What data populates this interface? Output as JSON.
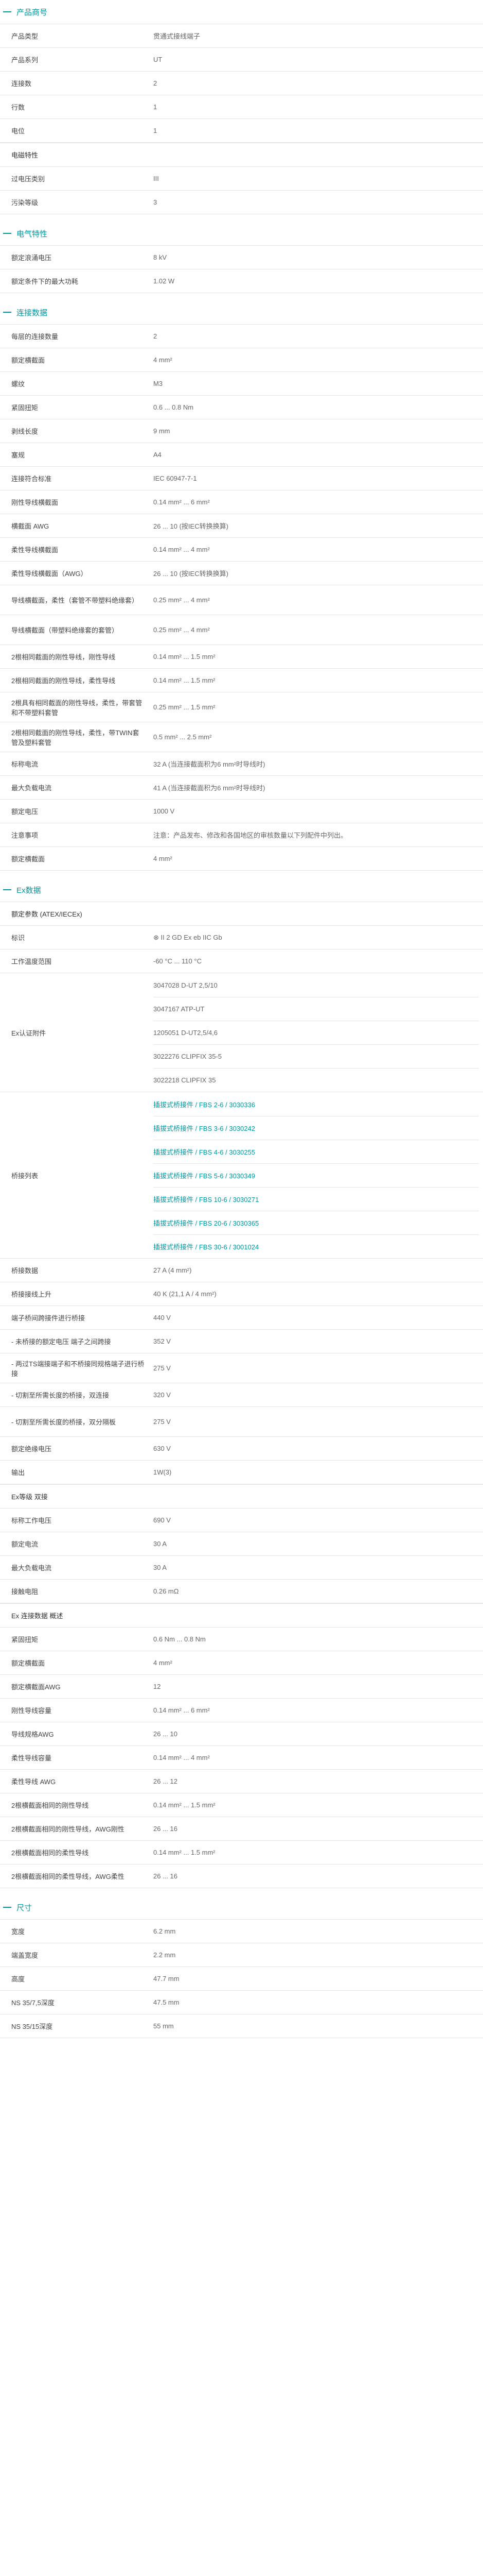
{
  "sections": [
    {
      "title": "产品商号",
      "blocks": [
        {
          "rows": [
            {
              "k": "产品类型",
              "v": [
                "贯通式接线端子"
              ],
              "h": 46
            },
            {
              "k": "产品系列",
              "v": [
                "UT"
              ],
              "h": 46
            },
            {
              "k": "连接数",
              "v": [
                "2"
              ],
              "h": 46
            },
            {
              "k": "行数",
              "v": [
                "1"
              ],
              "h": 46
            },
            {
              "k": "电位",
              "v": [
                "1"
              ],
              "h": 46
            }
          ]
        },
        {
          "subhead": "电磁特性"
        },
        {
          "rows": [
            {
              "k": "过电压类别",
              "v": [
                "III"
              ],
              "h": 46
            },
            {
              "k": "污染等级",
              "v": [
                "3"
              ],
              "h": 46
            }
          ]
        }
      ]
    },
    {
      "title": "电气特性",
      "blocks": [
        {
          "rows": [
            {
              "k": "额定浪涌电压",
              "v": [
                "8 kV"
              ],
              "h": 46
            },
            {
              "k": "额定条件下的最大功耗",
              "v": [
                "1.02 W"
              ],
              "h": 46
            }
          ]
        }
      ]
    },
    {
      "title": "连接数据",
      "blocks": [
        {
          "rows": [
            {
              "k": "每层的连接数量",
              "v": [
                "2"
              ],
              "h": 46
            },
            {
              "k": "额定横截面",
              "v": [
                "4 mm²"
              ],
              "h": 46
            },
            {
              "k": "螺纹",
              "v": [
                "M3"
              ],
              "h": 46
            },
            {
              "k": "紧固扭矩",
              "v": [
                "0.6 ... 0.8 Nm"
              ],
              "h": 46
            },
            {
              "k": "剥线长度",
              "v": [
                "9 mm"
              ],
              "h": 46
            },
            {
              "k": "塞规",
              "v": [
                "A4"
              ],
              "h": 46
            },
            {
              "k": "连接符合标准",
              "v": [
                "IEC 60947-7-1"
              ],
              "h": 46
            },
            {
              "k": "刚性导线横截面",
              "v": [
                "0.14 mm² ... 6 mm²"
              ],
              "h": 46
            },
            {
              "k": "横截面 AWG",
              "v": [
                "26 ... 10 (按IEC转换换算)"
              ],
              "h": 46
            },
            {
              "k": "柔性导线横截面",
              "v": [
                "0.14 mm² ... 4 mm²"
              ],
              "h": 46
            },
            {
              "k": "柔性导线横截面（AWG）",
              "v": [
                "26 ... 10 (按IEC转换换算)"
              ],
              "h": 46
            },
            {
              "k": "导线横截面，柔性（套管不带塑料绝缘套）",
              "v": [
                "0.25 mm² ... 4 mm²"
              ],
              "h": 58
            },
            {
              "k": "导线横截面（带塑料绝缘套的套管）",
              "v": [
                "0.25 mm² ... 4 mm²"
              ],
              "h": 58
            },
            {
              "k": "2根相同截面的刚性导线，刚性导线",
              "v": [
                "0.14 mm² ... 1.5 mm²"
              ],
              "h": 46
            },
            {
              "k": "2根相同截面的刚性导线，柔性导线",
              "v": [
                "0.14 mm² ... 1.5 mm²"
              ],
              "h": 46
            },
            {
              "k": "2根具有相同截面的刚性导线，柔性，带套管和不带塑料套管",
              "v": [
                "0.25 mm² ... 1.5 mm²"
              ],
              "h": 58
            },
            {
              "k": "2根相同截面的刚性导线，柔性，带TWIN套管及塑料套管",
              "v": [
                "0.5 mm² ... 2.5 mm²"
              ],
              "h": 58
            },
            {
              "k": "标称电流",
              "v": [
                "32 A (当连接截面积为6 mm²时导线时)"
              ],
              "h": 46
            },
            {
              "k": "最大负载电流",
              "v": [
                "41 A (当连接截面积为6 mm²时导线时)"
              ],
              "h": 46
            },
            {
              "k": "额定电压",
              "v": [
                "1000 V"
              ],
              "h": 46
            },
            {
              "k": "注意事项",
              "v": [
                "注意：产品发布、修改和各国地区的审核数量以下列配件中列出。"
              ],
              "h": 46
            },
            {
              "k": "额定横截面",
              "v": [
                "4 mm²"
              ],
              "h": 46
            }
          ]
        }
      ]
    },
    {
      "title": "Ex数据",
      "blocks": [
        {
          "subhead": "额定参数 (ATEX/IECEx)"
        },
        {
          "rows": [
            {
              "k": "标识",
              "v": [
                "⊗ II 2 GD Ex eb IIC Gb"
              ],
              "h": 46
            },
            {
              "k": "工作温度范围",
              "v": [
                "-60 °C ... 110 °C"
              ],
              "h": 46
            },
            {
              "k": "Ex认证附件",
              "v": [
                "3047028 D-UT 2,5/10",
                "3047167 ATP-UT",
                "1205051 D-UT2,5/4,6",
                "3022276 CLIPFIX 35-5",
                "3022218 CLIPFIX 35"
              ],
              "h": 46
            },
            {
              "k": "桥接列表",
              "v": [
                "插拔式桥接件 / FBS 2-6 / 3030336",
                "插拔式桥接件 / FBS 3-6 / 3030242",
                "插拔式桥接件 / FBS 4-6 / 3030255",
                "插拔式桥接件 / FBS 5-6 / 3030349",
                "插拔式桥接件 / FBS 10-6 / 3030271",
                "插拔式桥接件 / FBS 20-6 / 3030365",
                "插拔式桥接件 / FBS 30-6 / 3001024"
              ],
              "h": 46,
              "link": true
            },
            {
              "k": "桥接数据",
              "v": [
                "27 A (4 mm²)"
              ],
              "h": 46
            },
            {
              "k": "桥接接线上升",
              "v": [
                "40 K (21,1 A / 4 mm²)"
              ],
              "h": 46
            },
            {
              "k": "端子桥间跨接件进行桥接",
              "v": [
                "440 V"
              ],
              "h": 46
            },
            {
              "k": "- 未桥接的额定电压 端子之间跨接",
              "v": [
                "352 V"
              ],
              "h": 46
            },
            {
              "k": "- 两过TS端接端子和不桥接同规格端子进行桥接",
              "v": [
                "275 V"
              ],
              "h": 58
            },
            {
              "k": "- 切割至所需长度的桥接，双连接",
              "v": [
                "320 V"
              ],
              "h": 46
            },
            {
              "k": "- 切割至所需长度的桥接，双分隔板",
              "v": [
                "275 V"
              ],
              "h": 58
            },
            {
              "k": "额定绝缘电压",
              "v": [
                "630 V"
              ],
              "h": 46
            },
            {
              "k": "输出",
              "v": [
                "1W(3)"
              ],
              "h": 46
            }
          ]
        },
        {
          "subhead": "Ex等级 双接"
        },
        {
          "rows": [
            {
              "k": "标称工作电压",
              "v": [
                "690 V"
              ],
              "h": 46
            },
            {
              "k": "额定电流",
              "v": [
                "30 A"
              ],
              "h": 46
            },
            {
              "k": "最大负载电流",
              "v": [
                "30 A"
              ],
              "h": 46
            },
            {
              "k": "接触电阻",
              "v": [
                "0.26 mΩ"
              ],
              "h": 46
            }
          ]
        },
        {
          "subhead": "Ex 连接数据 概述"
        },
        {
          "rows": [
            {
              "k": "紧固扭矩",
              "v": [
                "0.6 Nm ... 0.8 Nm"
              ],
              "h": 46
            },
            {
              "k": "额定横截面",
              "v": [
                "4 mm²"
              ],
              "h": 46
            },
            {
              "k": "额定横截面AWG",
              "v": [
                "12"
              ],
              "h": 46
            },
            {
              "k": "刚性导线容量",
              "v": [
                "0.14 mm² ... 6 mm²"
              ],
              "h": 46
            },
            {
              "k": "导线规格AWG",
              "v": [
                "26 ... 10"
              ],
              "h": 46
            },
            {
              "k": "柔性导线容量",
              "v": [
                "0.14 mm² ... 4 mm²"
              ],
              "h": 46
            },
            {
              "k": "柔性导线 AWG",
              "v": [
                "26 ... 12"
              ],
              "h": 46
            },
            {
              "k": "2根横截面相同的刚性导线",
              "v": [
                "0.14 mm² ... 1.5 mm²"
              ],
              "h": 46
            },
            {
              "k": "2根横截面相同的刚性导线，AWG刚性",
              "v": [
                "26 ... 16"
              ],
              "h": 46
            },
            {
              "k": "2根横截面相同的柔性导线",
              "v": [
                "0.14 mm² ... 1.5 mm²"
              ],
              "h": 46
            },
            {
              "k": "2根横截面相同的柔性导线，AWG柔性",
              "v": [
                "26 ... 16"
              ],
              "h": 46
            }
          ]
        }
      ]
    },
    {
      "title": "尺寸",
      "blocks": [
        {
          "rows": [
            {
              "k": "宽度",
              "v": [
                "6.2 mm"
              ],
              "h": 46
            },
            {
              "k": "端盖宽度",
              "v": [
                "2.2 mm"
              ],
              "h": 46
            },
            {
              "k": "高度",
              "v": [
                "47.7 mm"
              ],
              "h": 46
            },
            {
              "k": "NS 35/7,5深度",
              "v": [
                "47.5 mm"
              ],
              "h": 46
            },
            {
              "k": "NS 35/15深度",
              "v": [
                "55 mm"
              ],
              "h": 46
            }
          ]
        }
      ]
    }
  ]
}
